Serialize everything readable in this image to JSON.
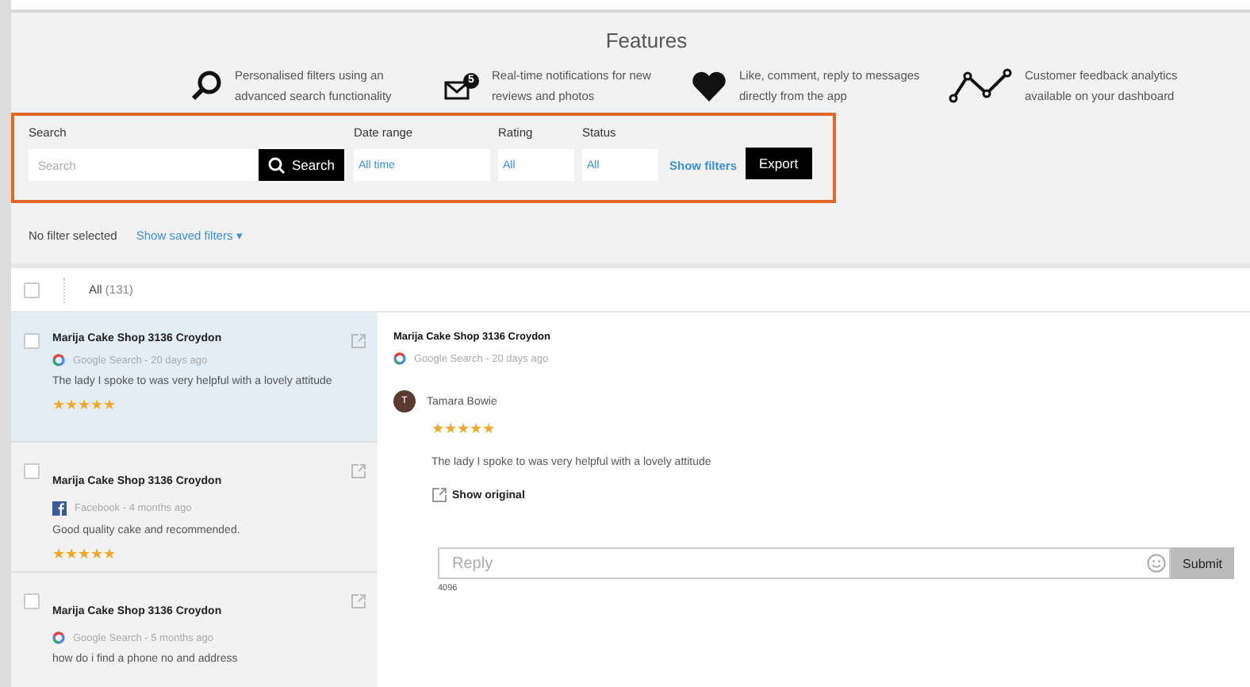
{
  "features": {
    "title": "Features",
    "items": [
      {
        "kind": "search",
        "text": "Personalised filters using an advanced search functionality"
      },
      {
        "kind": "mail",
        "badge": "5",
        "text": "Real-time notifications for new reviews and photos"
      },
      {
        "kind": "heart",
        "text": "Like, comment, reply to messages directly from the app"
      },
      {
        "kind": "chart",
        "text": "Customer feedback analytics available on your dashboard"
      }
    ]
  },
  "filters": {
    "search_label": "Search",
    "search_placeholder": "Search",
    "search_button": "Search",
    "date_label": "Date range",
    "date_value": "All time",
    "rating_label": "Rating",
    "rating_value": "All",
    "status_label": "Status",
    "status_value": "All",
    "show_filters": "Show filters",
    "export": "Export"
  },
  "saved": {
    "status": "No filter selected",
    "link": "Show saved filters",
    "caret": "▾"
  },
  "list_header": {
    "checked": false,
    "label": "All",
    "count": "(131)"
  },
  "reviews": [
    {
      "title": "Marija Cake Shop 3136 Croydon",
      "kind": "google",
      "meta": "Google Search - 20 days ago",
      "text": "The lady I spoke to was very helpful with a lovely attitude",
      "stars": 5,
      "selected": true,
      "checked": false
    },
    {
      "title": "Marija Cake Shop 3136 Croydon",
      "kind": "facebook",
      "meta": "Facebook - 4 months ago",
      "text": "Good quality cake and recommended.",
      "stars": 5,
      "selected": false,
      "checked": false
    },
    {
      "title": "Marija Cake Shop 3136 Croydon",
      "kind": "google",
      "meta": "Google Search - 5 months ago",
      "text": "how do i find a phone no and address",
      "selected": false,
      "checked": false
    }
  ],
  "detail": {
    "title": "Marija Cake Shop 3136 Croydon",
    "meta": "Google Search - 20 days ago",
    "avatar": "T",
    "author": "Tamara Bowie",
    "stars": 5,
    "text": "The lady I spoke to was very helpful with a lovely attitude",
    "show_original": "Show original",
    "reply_placeholder": "Reply",
    "counter": "4096",
    "submit": "Submit"
  }
}
